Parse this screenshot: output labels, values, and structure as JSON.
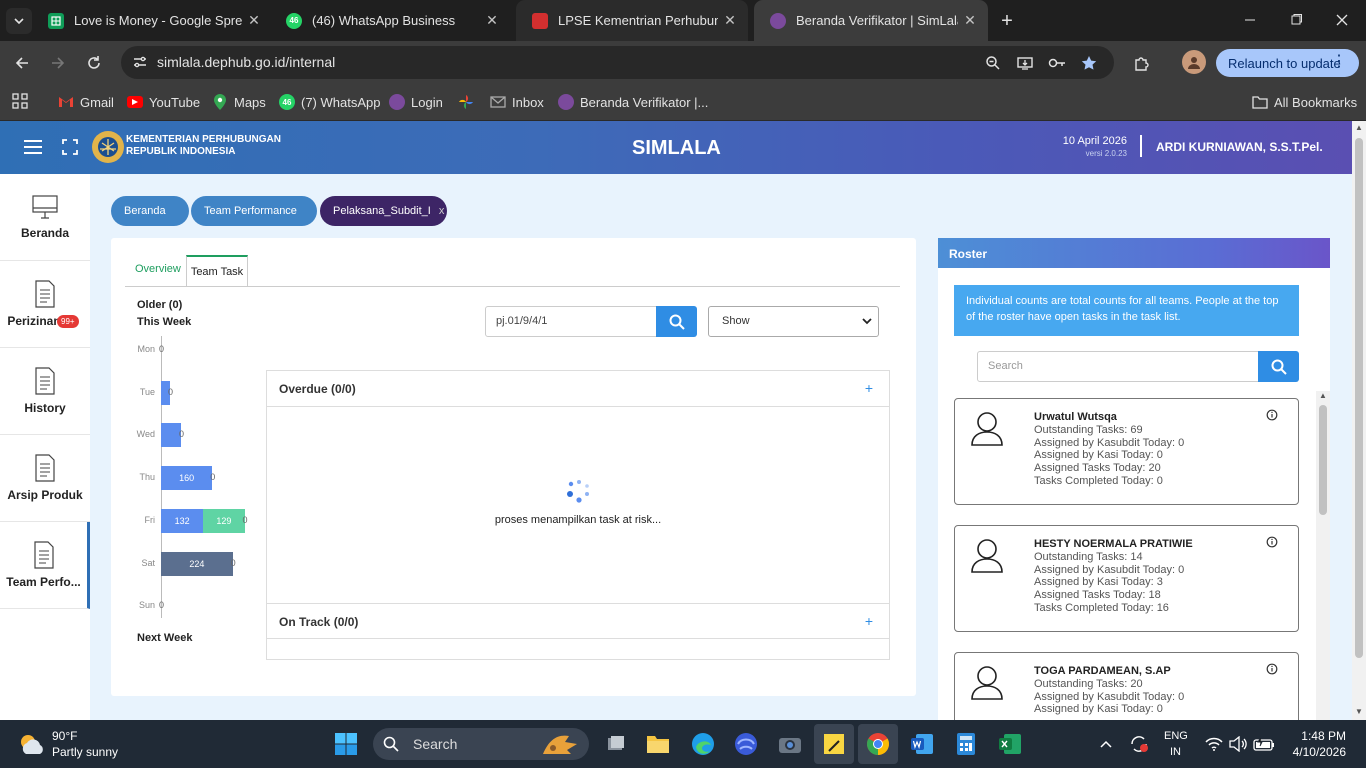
{
  "browser": {
    "tabs": [
      {
        "title": "Love is Money - Google Spread"
      },
      {
        "title": "(46) WhatsApp Business",
        "badge": "46"
      },
      {
        "title": "LPSE Kementrian Perhubungan"
      },
      {
        "title": "Beranda Verifikator | SimLala"
      }
    ],
    "address": "simlala.dephub.go.id/internal",
    "relaunch_label": "Relaunch to update",
    "bookmarks": [
      {
        "label": "Gmail"
      },
      {
        "label": "YouTube"
      },
      {
        "label": "Maps"
      },
      {
        "label": "(7) WhatsApp",
        "badge": "46"
      },
      {
        "label": "Login"
      },
      {
        "label": ""
      },
      {
        "label": "Inbox"
      },
      {
        "label": "Beranda Verifikator |..."
      }
    ],
    "all_bookmarks": "All Bookmarks"
  },
  "app": {
    "org_line1": "KEMENTERIAN PERHUBUNGAN",
    "org_line2": "REPUBLIK INDONESIA",
    "name": "SIMLALA",
    "date": "10 April 2026",
    "version": "versi 2.0.23",
    "user": "ARDI KURNIAWAN, S.S.T.Pel."
  },
  "sidenav": [
    {
      "label": "Beranda"
    },
    {
      "label": "Perizinan",
      "badge": "99+"
    },
    {
      "label": "History"
    },
    {
      "label": "Arsip Produk"
    },
    {
      "label": "Team Perfo..."
    }
  ],
  "breadcrumbs": [
    "Beranda",
    "Team Performance",
    "Pelaksana_Subdit_I"
  ],
  "breadcrumb_close": "x",
  "tabs": [
    "Overview",
    "Team Task"
  ],
  "chart_data": {
    "type": "bar",
    "orientation": "horizontal",
    "stacked": true,
    "header_older": "Older (0)",
    "header_this_week": "This Week",
    "footer": "Next Week",
    "categories": [
      "Mon",
      "Tue",
      "Wed",
      "Thu",
      "Fri",
      "Sat",
      "Sun"
    ],
    "series": [
      {
        "color": "#5b8def",
        "values": [
          0,
          0,
          0,
          160,
          132,
          0,
          0
        ]
      },
      {
        "color": "#5fd4a4",
        "values": [
          0,
          0,
          0,
          0,
          129,
          0,
          0
        ]
      },
      {
        "color": "#5b6f8f",
        "values": [
          0,
          0,
          0,
          0,
          0,
          224,
          0
        ]
      }
    ],
    "data_labels": {
      "Mon": [
        "0"
      ],
      "Tue": [
        "0"
      ],
      "Wed": [
        "0"
      ],
      "Thu": [
        "160",
        "0"
      ],
      "Fri": [
        "132",
        "129",
        "0"
      ],
      "Sat": [
        "0",
        "224"
      ],
      "Sun": [
        "0"
      ]
    }
  },
  "search_value": "pj.01/9/4/1",
  "show_select": "Show",
  "sections": {
    "overdue": "Overdue (0/0)",
    "on_track": "On Track (0/0)",
    "expand": "+",
    "loading_text": "proses menampilkan task at risk..."
  },
  "roster": {
    "title": "Roster",
    "info": "Individual counts are total counts for all teams. People at the top of the roster have open tasks in the task list.",
    "search_placeholder": "Search",
    "people": [
      {
        "name": "Urwatul Wutsqa",
        "lines": [
          "Outstanding Tasks: 69",
          "Assigned by Kasubdit Today: 0",
          "Assigned by Kasi Today: 0",
          "Assigned Tasks Today: 20",
          "Tasks Completed Today: 0"
        ]
      },
      {
        "name": "HESTY NOERMALA PRATIWIE",
        "lines": [
          "Outstanding Tasks: 14",
          "Assigned by Kasubdit Today: 0",
          "Assigned by Kasi Today: 3",
          "Assigned Tasks Today: 18",
          "Tasks Completed Today: 16"
        ]
      },
      {
        "name": "TOGA PARDAMEAN, S.AP",
        "lines": [
          "Outstanding Tasks: 20",
          "Assigned by Kasubdit Today: 0",
          "Assigned by Kasi Today: 0"
        ]
      }
    ]
  },
  "taskbar": {
    "weather_temp": "90°F",
    "weather_desc": "Partly sunny",
    "search_label": "Search",
    "lang1": "ENG",
    "lang2": "IN",
    "time": "1:48 PM",
    "date": "4/10/2026"
  }
}
